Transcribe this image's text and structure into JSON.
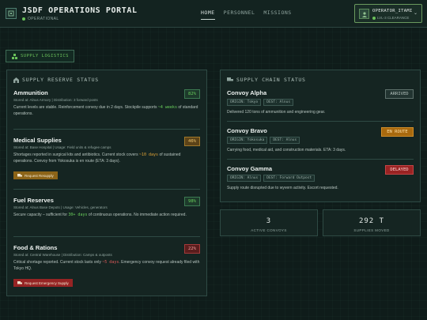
{
  "header": {
    "title": "JSDF OPERATIONS PORTAL",
    "status": "OPERATIONAL",
    "nav": [
      "HOME",
      "PERSONNEL",
      "MISSIONS"
    ],
    "active_nav": "HOME",
    "user": {
      "name": "OPERATOR_ITAMI",
      "level": "LVL-3 CLEARANCE"
    }
  },
  "section_tag": "SUPPLY LOGISTICS",
  "supply_reserve": {
    "heading": "SUPPLY RESERVE STATUS",
    "items": [
      {
        "name": "Ammunition",
        "meta": "Stored at: Alnus Armory | Distribution: 3 forward posts",
        "percent": "82%",
        "desc_before": "Current levels are stable. Reinforcement convoy due in 2 days. Stockpile supports ",
        "desc_highlight": "~4 weeks",
        "desc_after": " of standard operations."
      },
      {
        "name": "Medical Supplies",
        "meta": "Stored at: Base Hospital | Usage: Field units & refugee camps",
        "percent": "46%",
        "desc_before": "Shortages reported in surgical kits and antibiotics. Current stock covers ",
        "desc_highlight": "~10 days",
        "desc_after": " of sustained operations. Convoy from Yokosuka is en route (ETA: 3 days).",
        "action": "Request Resupply"
      },
      {
        "name": "Fuel Reserves",
        "meta": "Stored at: Alnus Base Depots | Usage: Vehicles, generators",
        "percent": "98%",
        "desc_before": "Secure capacity – sufficient for ",
        "desc_highlight": "30+ days",
        "desc_after": " of continuous operations. No immediate action required."
      },
      {
        "name": "Food & Rations",
        "meta": "Stored at: Central Warehouse | Distribution: Camps & outposts",
        "percent": "22%",
        "desc_before": "Critical shortage reported. Current stock lasts only ",
        "desc_highlight": "~5 days",
        "desc_after": ". Emergency convoy request already filed with Tokyo HQ.",
        "action": "Request Emergency Supply"
      }
    ]
  },
  "supply_chain": {
    "heading": "SUPPLY CHAIN STATUS",
    "convoys": [
      {
        "name": "Convoy Alpha",
        "origin": "ORIGIN: Tokyo",
        "dest": "DEST: Alnus",
        "status": "ARRIVED",
        "desc": "Delivered 120 tons of ammunition and engineering gear."
      },
      {
        "name": "Convoy Bravo",
        "origin": "ORIGIN: Yokosuka",
        "dest": "DEST: Alnus",
        "status": "EN ROUTE",
        "desc": "Carrying food, medical aid, and construction materials. ETA: 3 days."
      },
      {
        "name": "Convoy Gamma",
        "origin": "ORIGIN: Alnus",
        "dest": "DEST: Forward Outpost",
        "status": "DELAYED",
        "desc": "Supply route disrupted due to wyvern activity. Escort requested."
      }
    ]
  },
  "stats": [
    {
      "value": "3",
      "label": "ACTIVE CONVOYS"
    },
    {
      "value": "292 T",
      "label": "SUPPLIES MOVED"
    }
  ],
  "colors": {
    "accent": "#6ac15a",
    "warning": "#e0a336",
    "danger": "#e05b5b"
  }
}
